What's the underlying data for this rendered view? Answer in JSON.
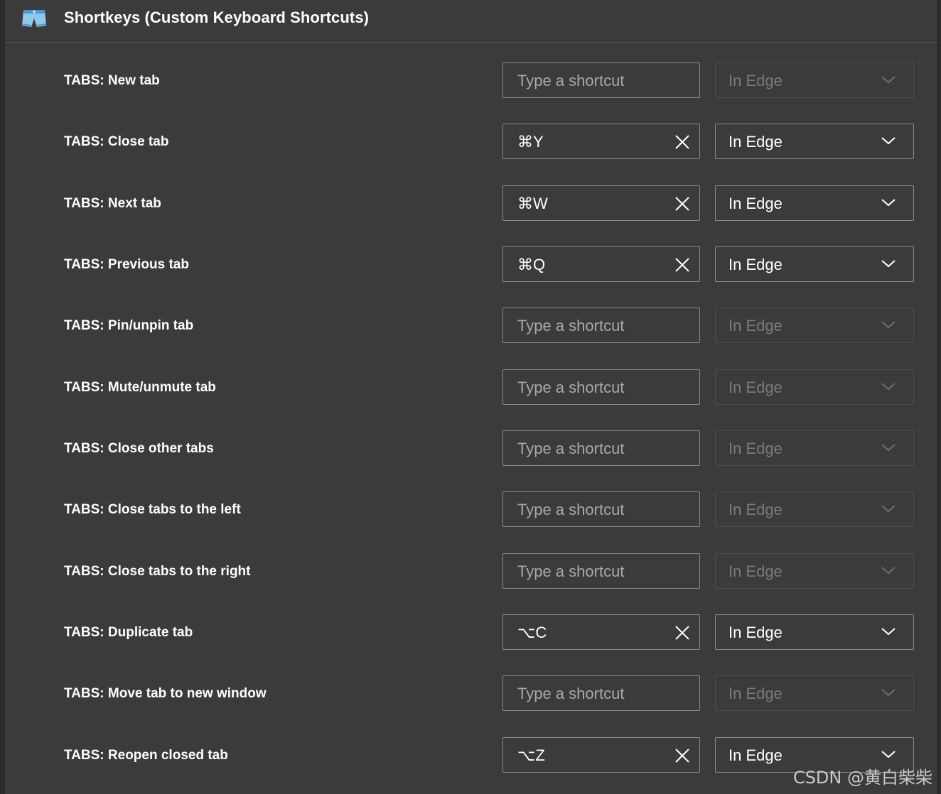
{
  "extension": {
    "title": "Shortkeys (Custom Keyboard Shortcuts)",
    "icon": "shorts-icon"
  },
  "rows": [
    {
      "label": "TABS: New tab",
      "shortcut": "",
      "placeholder": "Type a shortcut",
      "scope": "In Edge",
      "active": false
    },
    {
      "label": "TABS: Close tab",
      "shortcut": "⌘Y",
      "placeholder": "Type a shortcut",
      "scope": "In Edge",
      "active": true
    },
    {
      "label": "TABS: Next tab",
      "shortcut": "⌘W",
      "placeholder": "Type a shortcut",
      "scope": "In Edge",
      "active": true
    },
    {
      "label": "TABS: Previous tab",
      "shortcut": "⌘Q",
      "placeholder": "Type a shortcut",
      "scope": "In Edge",
      "active": true
    },
    {
      "label": "TABS: Pin/unpin tab",
      "shortcut": "",
      "placeholder": "Type a shortcut",
      "scope": "In Edge",
      "active": false
    },
    {
      "label": "TABS: Mute/unmute tab",
      "shortcut": "",
      "placeholder": "Type a shortcut",
      "scope": "In Edge",
      "active": false
    },
    {
      "label": "TABS: Close other tabs",
      "shortcut": "",
      "placeholder": "Type a shortcut",
      "scope": "In Edge",
      "active": false
    },
    {
      "label": "TABS: Close tabs to the left",
      "shortcut": "",
      "placeholder": "Type a shortcut",
      "scope": "In Edge",
      "active": false
    },
    {
      "label": "TABS: Close tabs to the right",
      "shortcut": "",
      "placeholder": "Type a shortcut",
      "scope": "In Edge",
      "active": false
    },
    {
      "label": "TABS: Duplicate tab",
      "shortcut": "⌥C",
      "placeholder": "Type a shortcut",
      "scope": "In Edge",
      "active": true
    },
    {
      "label": "TABS: Move tab to new window",
      "shortcut": "",
      "placeholder": "Type a shortcut",
      "scope": "In Edge",
      "active": false
    },
    {
      "label": "TABS: Reopen closed tab",
      "shortcut": "⌥Z",
      "placeholder": "Type a shortcut",
      "scope": "In Edge",
      "active": true
    }
  ],
  "watermark": "CSDN @黄白柴柴",
  "colors": {
    "background": "#3b3b3b",
    "text": "#ffffff",
    "placeholder": "#a8a8a8",
    "disabled": "#7a7a7a"
  }
}
